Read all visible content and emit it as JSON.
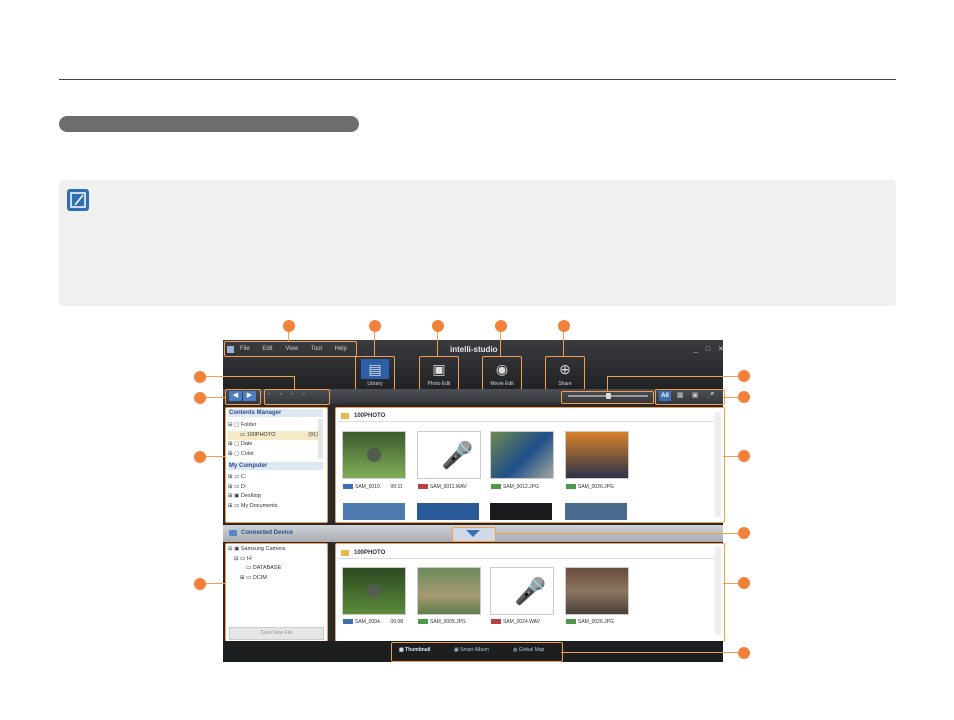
{
  "app": {
    "brand": "intelli-studio",
    "menu": [
      "File",
      "Edit",
      "View",
      "Tool",
      "Help"
    ],
    "window_controls": "_ □ ✕",
    "toolbar": [
      {
        "label": "Library",
        "icon": "library-icon"
      },
      {
        "label": "Photo Edit",
        "icon": "photo-edit-icon"
      },
      {
        "label": "Movie Edit",
        "icon": "movie-edit-icon"
      },
      {
        "label": "Share",
        "icon": "share-icon"
      }
    ],
    "view_filters": [
      "All",
      "▦",
      "▣",
      "🎤"
    ],
    "left_panel": {
      "contents_manager": "Contents Manager",
      "items": [
        "Folder",
        "100PHOTO",
        "Date",
        "Color"
      ],
      "folder_count": "(91)",
      "my_computer": "My Computer",
      "computer_items": [
        "C:",
        "D:",
        "Desktop",
        "My Documents"
      ]
    },
    "top_grid": {
      "folder": "100PHOTO",
      "files": [
        {
          "name": "SAM_0010.",
          "meta": "00:11",
          "tag_color": "#3c6fb4"
        },
        {
          "name": "SAM_0011.WAV",
          "meta": "",
          "tag_color": "#b84040"
        },
        {
          "name": "SAM_0012.JPG",
          "meta": "",
          "tag_color": "#4a9a4a"
        },
        {
          "name": "SAM_0026.JPG",
          "meta": "",
          "tag_color": "#4a9a4a"
        }
      ]
    },
    "connected_device": "Connected Device",
    "device_tree": [
      "Samsung Camera",
      "H:",
      "DATABASE",
      "DCIM"
    ],
    "save_new_file": "Save New File",
    "bottom_grid": {
      "folder": "100PHOTO",
      "files": [
        {
          "name": "SAM_0004.",
          "meta": "00:08",
          "tag_color": "#3c6fb4"
        },
        {
          "name": "SAM_0005.JPG",
          "meta": "",
          "tag_color": "#4a9a4a"
        },
        {
          "name": "SAM_0024.WAV",
          "meta": "",
          "tag_color": "#b84040"
        },
        {
          "name": "SAM_0026.JPG",
          "meta": "",
          "tag_color": "#4a9a4a"
        }
      ]
    },
    "bottom_tabs": [
      "Thumbnail",
      "Smart Album",
      "Global Map"
    ]
  }
}
